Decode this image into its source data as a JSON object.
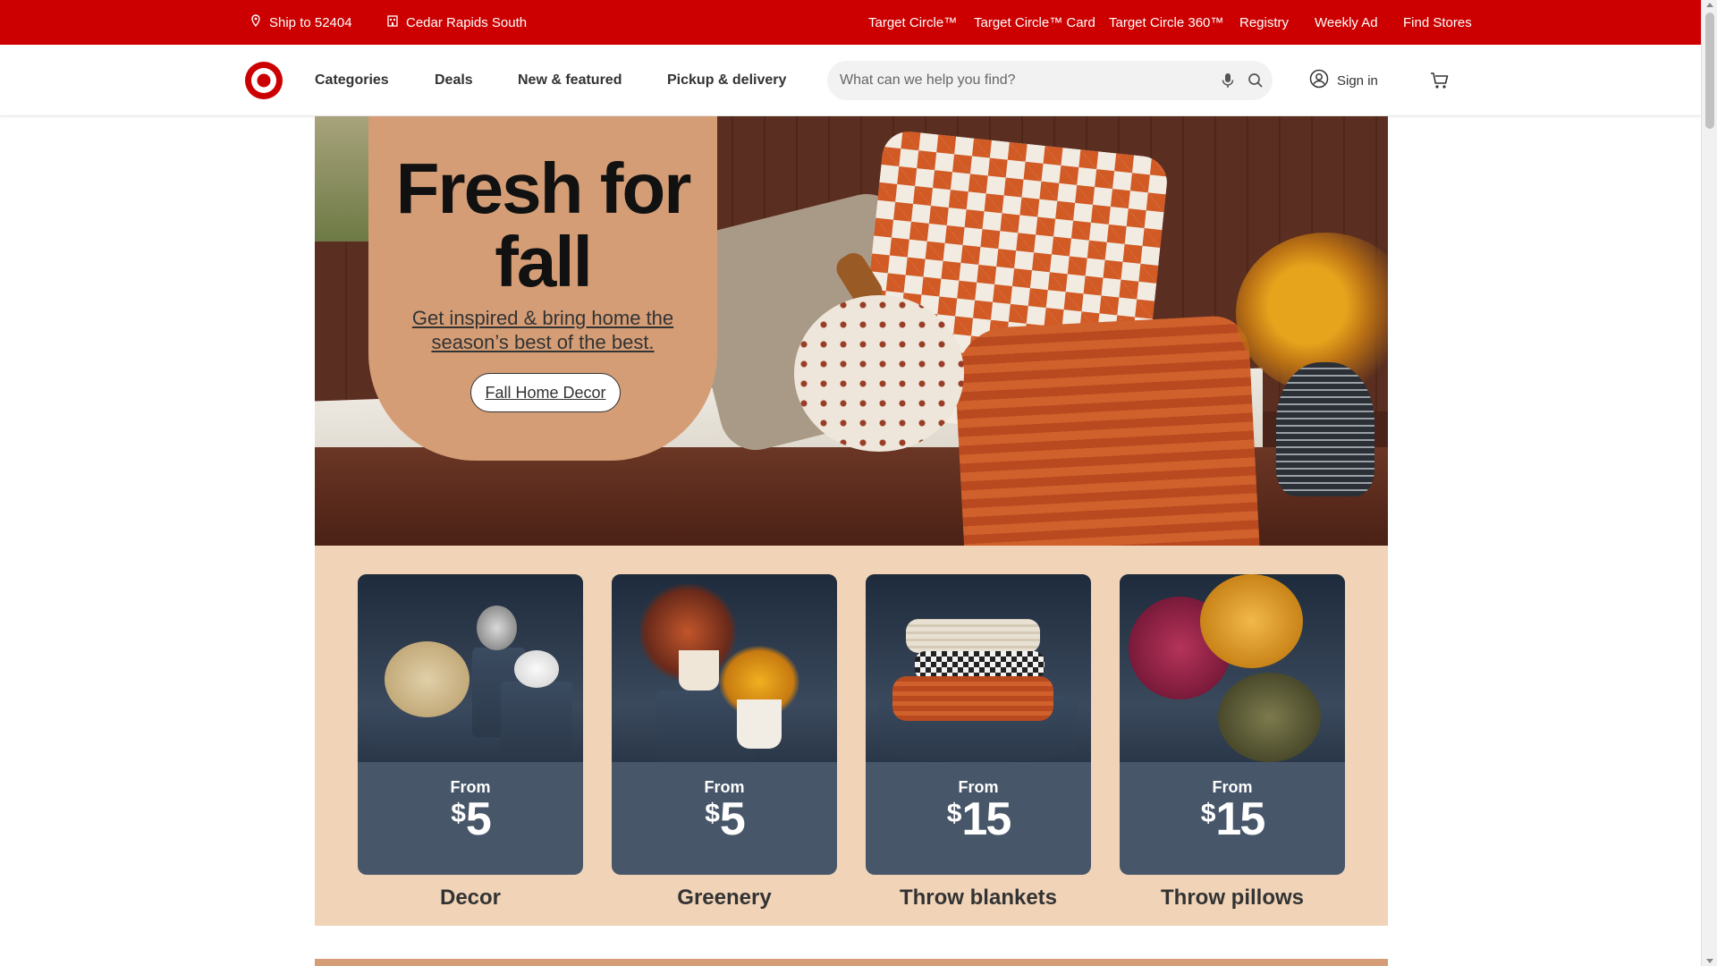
{
  "utility": {
    "ship_to": "Ship to 52404",
    "store": "Cedar Rapids South",
    "links": [
      "Target Circle™",
      "Target Circle™ Card",
      "Target Circle 360™",
      "Registry",
      "Weekly Ad",
      "Find Stores"
    ]
  },
  "header": {
    "logo_icon": "target-bullseye-logo",
    "nav": [
      "Categories",
      "Deals",
      "New & featured",
      "Pickup & delivery"
    ],
    "search_placeholder": "What can we help you find?",
    "sign_in": "Sign in"
  },
  "hero": {
    "headline": "Fresh for fall",
    "subtext": "Get inspired & bring home the season’s best of the best.",
    "cta": "Fall Home Decor"
  },
  "categories": [
    {
      "from": "From",
      "currency": "$",
      "amount": "5",
      "label": "Decor"
    },
    {
      "from": "From",
      "currency": "$",
      "amount": "5",
      "label": "Greenery"
    },
    {
      "from": "From",
      "currency": "$",
      "amount": "15",
      "label": "Throw blankets"
    },
    {
      "from": "From",
      "currency": "$",
      "amount": "15",
      "label": "Throw pillows"
    }
  ],
  "colors": {
    "brand_red": "#cc0000",
    "promo_tan": "#d49d76",
    "category_band": "#f1d4b8",
    "card_slate": "#475669"
  }
}
